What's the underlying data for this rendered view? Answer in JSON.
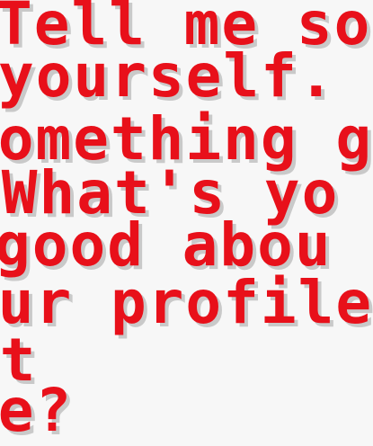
{
  "dialogue": {
    "lines": [
      "Tell me so",
      "yourself.",
      "something g",
      " What's yo",
      "good abou",
      "our profile",
      "at",
      "me?"
    ],
    "text_color": "#e8101a",
    "shadow_color": "#c9c9c9",
    "background_color": "#f7f7f7"
  }
}
